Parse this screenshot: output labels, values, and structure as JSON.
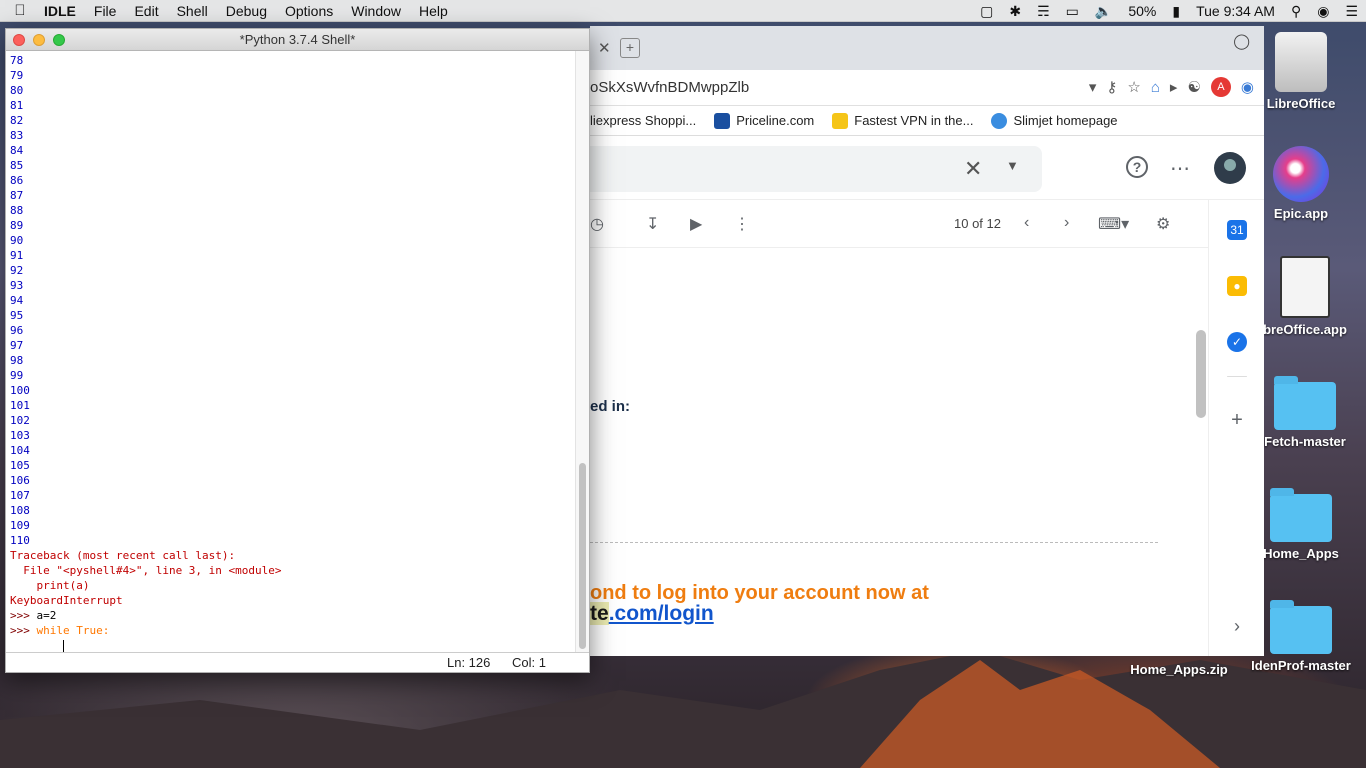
{
  "menubar": {
    "app": "IDLE",
    "items": [
      "File",
      "Edit",
      "Shell",
      "Debug",
      "Options",
      "Window",
      "Help"
    ],
    "battery": "50%",
    "clock": "Tue 9:34 AM"
  },
  "idle": {
    "title": "*Python 3.7.4 Shell*",
    "numbers": [
      "78",
      "79",
      "80",
      "81",
      "82",
      "83",
      "84",
      "85",
      "86",
      "87",
      "88",
      "89",
      "90",
      "91",
      "92",
      "93",
      "94",
      "95",
      "96",
      "97",
      "98",
      "99",
      "100",
      "101",
      "102",
      "103",
      "104",
      "105",
      "106",
      "107",
      "108",
      "109",
      "110"
    ],
    "traceback": [
      "Traceback (most recent call last):",
      "  File \"<pyshell#4>\", line 3, in <module>",
      "    print(a)",
      "KeyboardInterrupt"
    ],
    "prompt1": ">>> ",
    "cmd1": "a=2",
    "prompt2": ">>> ",
    "cmd2_kw": "while",
    "cmd2_rest": " True:",
    "status_ln": "Ln: 126",
    "status_col": "Col: 1"
  },
  "chrome": {
    "url": "oSkXsWvfnBDMwppZlb",
    "bookmarks": [
      {
        "label": "liexpress Shoppi...",
        "color": "#e62e04"
      },
      {
        "label": "Priceline.com",
        "color": "#1a4fa0"
      },
      {
        "label": "Fastest VPN in the...",
        "color": "#f5c518"
      },
      {
        "label": "Slimjet homepage",
        "color": "#3a8de0"
      }
    ],
    "avatar_letter": "A",
    "pagination": "10 of 12",
    "calendar_day": "31",
    "signed_in_text": "ed in:",
    "orange_text": "ond to log into your account now at",
    "login_pre": "te",
    "login_link": ".com/login"
  },
  "desktop": {
    "icons": [
      {
        "label": "LibreOffice"
      },
      {
        "label": "Epic.app"
      },
      {
        "label": "breOffice.app"
      },
      {
        "label": "Fetch-master"
      },
      {
        "label": "Home_Apps"
      },
      {
        "label": "Home_Apps.zip"
      },
      {
        "label": "IdenProf-master"
      }
    ]
  }
}
